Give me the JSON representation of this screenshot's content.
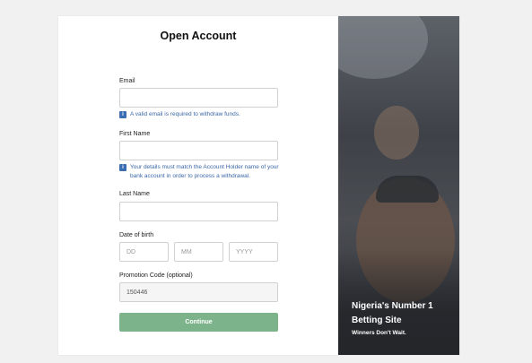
{
  "form": {
    "title": "Open Account",
    "email": {
      "label": "Email",
      "value": "",
      "placeholder": "",
      "hint": "A valid email is required to withdraw funds."
    },
    "first_name": {
      "label": "First Name",
      "value": "",
      "placeholder": "",
      "hint_line1": "Your details must match the Account Holder name of your",
      "hint_line2": "bank account in order to process a withdrawal."
    },
    "last_name": {
      "label": "Last Name",
      "value": "",
      "placeholder": ""
    },
    "dob": {
      "label": "Date of birth",
      "day_placeholder": "DD",
      "month_placeholder": "MM",
      "year_placeholder": "YYYY"
    },
    "promo": {
      "label": "Promotion Code (optional)",
      "value": "150446"
    },
    "continue_label": "Continue",
    "info_icon_glyph": "i"
  },
  "promo_panel": {
    "headline_line1": "Nigeria's Number 1",
    "headline_line2": "Betting Site",
    "subline": "Winners Don't Wait."
  },
  "colors": {
    "accent_button": "#7db38a",
    "hint_text": "#3b67a8",
    "info_icon": "#3b6db3"
  }
}
